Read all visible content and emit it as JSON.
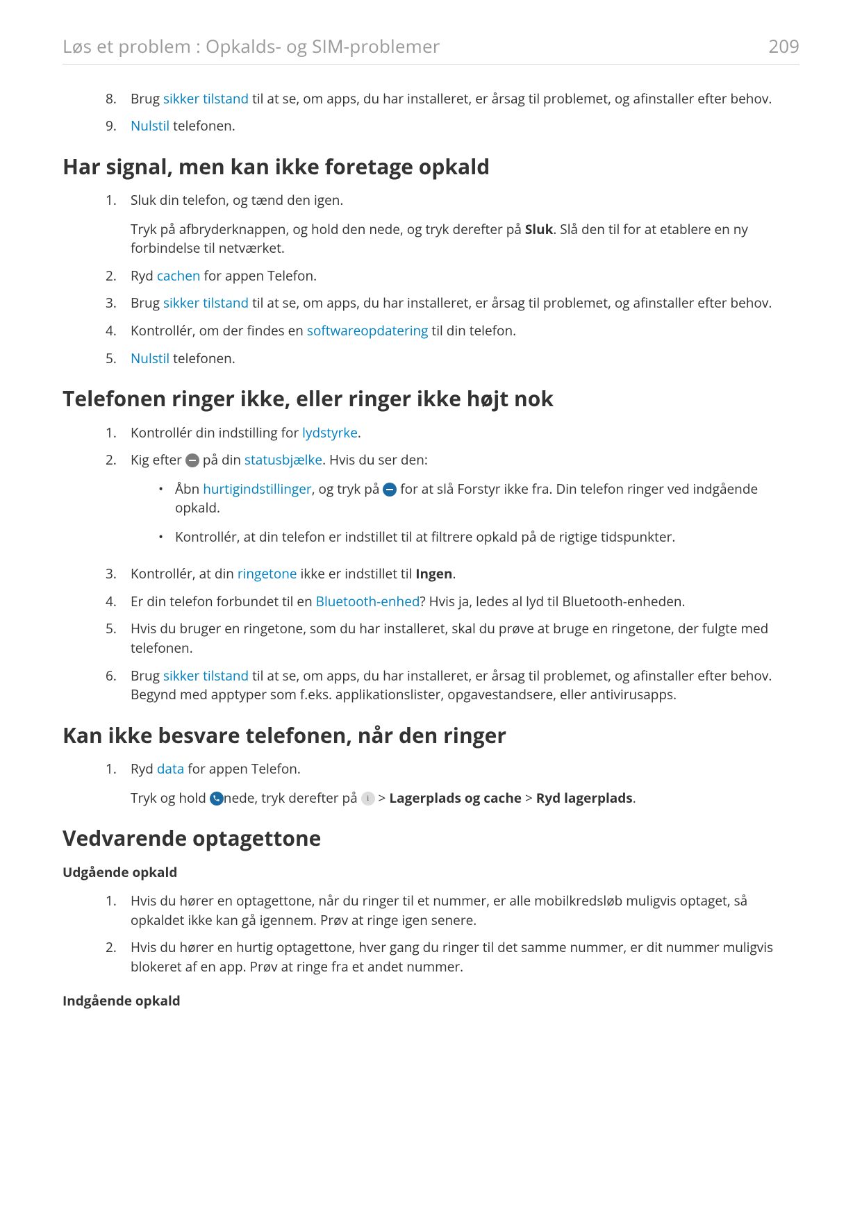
{
  "header": {
    "title": "Løs et problem : Opkalds- og SIM-problemer",
    "page": "209"
  },
  "list_a": {
    "n8": "8.",
    "i8_a": "Brug ",
    "i8_link": "sikker tilstand",
    "i8_b": " til at se, om apps, du har installeret, er årsag til problemet, og afinstaller efter behov.",
    "n9": "9.",
    "i9_link": "Nulstil",
    "i9_b": " telefonen."
  },
  "h2_a": "Har signal, men kan ikke foretage opkald",
  "list_b": {
    "n1": "1.",
    "i1_a": "Sluk din telefon, og tænd den igen.",
    "i1_p_a": "Tryk på afbryderknappen, og hold den nede, og tryk derefter på ",
    "i1_p_bold": "Sluk",
    "i1_p_b": ". Slå den til for at etablere en ny forbindelse til netværket.",
    "n2": "2.",
    "i2_a": "Ryd ",
    "i2_link": "cachen",
    "i2_b": " for appen Telefon.",
    "n3": "3.",
    "i3_a": "Brug ",
    "i3_link": "sikker tilstand",
    "i3_b": " til at se, om apps, du har installeret, er årsag til problemet, og afinstaller efter behov.",
    "n4": "4.",
    "i4_a": "Kontrollér, om der findes en ",
    "i4_link": "softwareopdatering",
    "i4_b": " til din telefon.",
    "n5": "5.",
    "i5_link": "Nulstil",
    "i5_b": " telefonen."
  },
  "h2_b": "Telefonen ringer ikke, eller ringer ikke højt nok",
  "list_c": {
    "n1": "1.",
    "i1_a": "Kontrollér din indstilling for ",
    "i1_link": "lydstyrke",
    "i1_b": ".",
    "n2": "2.",
    "i2_a": "Kig efter ",
    "i2_b": " på din ",
    "i2_link": "statusbjælke",
    "i2_c": ". Hvis du ser den:",
    "b1_a": "Åbn ",
    "b1_link": "hurtigindstillinger",
    "b1_b": ", og tryk på ",
    "b1_c": " for at slå Forstyr ikke fra. Din telefon ringer ved indgående opkald.",
    "b2": "Kontrollér, at din telefon er indstillet til at filtrere opkald på de rigtige tidspunkter.",
    "n3": "3.",
    "i3_a": "Kontrollér, at din ",
    "i3_link": "ringetone",
    "i3_b": " ikke er indstillet til ",
    "i3_bold": "Ingen",
    "i3_c": ".",
    "n4": "4.",
    "i4_a": "Er din telefon forbundet til en ",
    "i4_link": "Bluetooth-enhed",
    "i4_b": "? Hvis ja, ledes al lyd til Bluetooth-enheden.",
    "n5": "5.",
    "i5": "Hvis du bruger en ringetone, som du har installeret, skal du prøve at bruge en ringetone, der fulgte med telefonen.",
    "n6": "6.",
    "i6_a": "Brug ",
    "i6_link": "sikker tilstand",
    "i6_b": " til at se, om apps, du har installeret, er årsag til problemet, og afinstaller efter behov. Begynd med apptyper som f.eks. applikationslister, opgavestandsere, eller antivirusapps."
  },
  "h2_c": "Kan ikke besvare telefonen, når den ringer",
  "list_d": {
    "n1": "1.",
    "i1_a": "Ryd ",
    "i1_link": "data",
    "i1_b": " for appen Telefon.",
    "p_a": "Tryk og hold ",
    "p_b": "nede, tryk derefter på ",
    "p_c": " > ",
    "p_bold1": "Lagerplads og cache",
    "p_d": " > ",
    "p_bold2": "Ryd lagerplads",
    "p_e": "."
  },
  "h2_d": "Vedvarende optagettone",
  "sub_out": "Udgående opkald",
  "list_e": {
    "n1": "1.",
    "i1": "Hvis du hører en optagettone, når du ringer til et nummer, er alle mobilkredsløb muligvis optaget, så opkaldet ikke kan gå igennem. Prøv at ringe igen senere.",
    "n2": "2.",
    "i2": "Hvis du hører en hurtig optagettone, hver gang du ringer til det samme nummer, er dit nummer muligvis blokeret af en app. Prøv at ringe fra et andet nummer."
  },
  "sub_in": "Indgående opkald",
  "bullet_char": "•"
}
